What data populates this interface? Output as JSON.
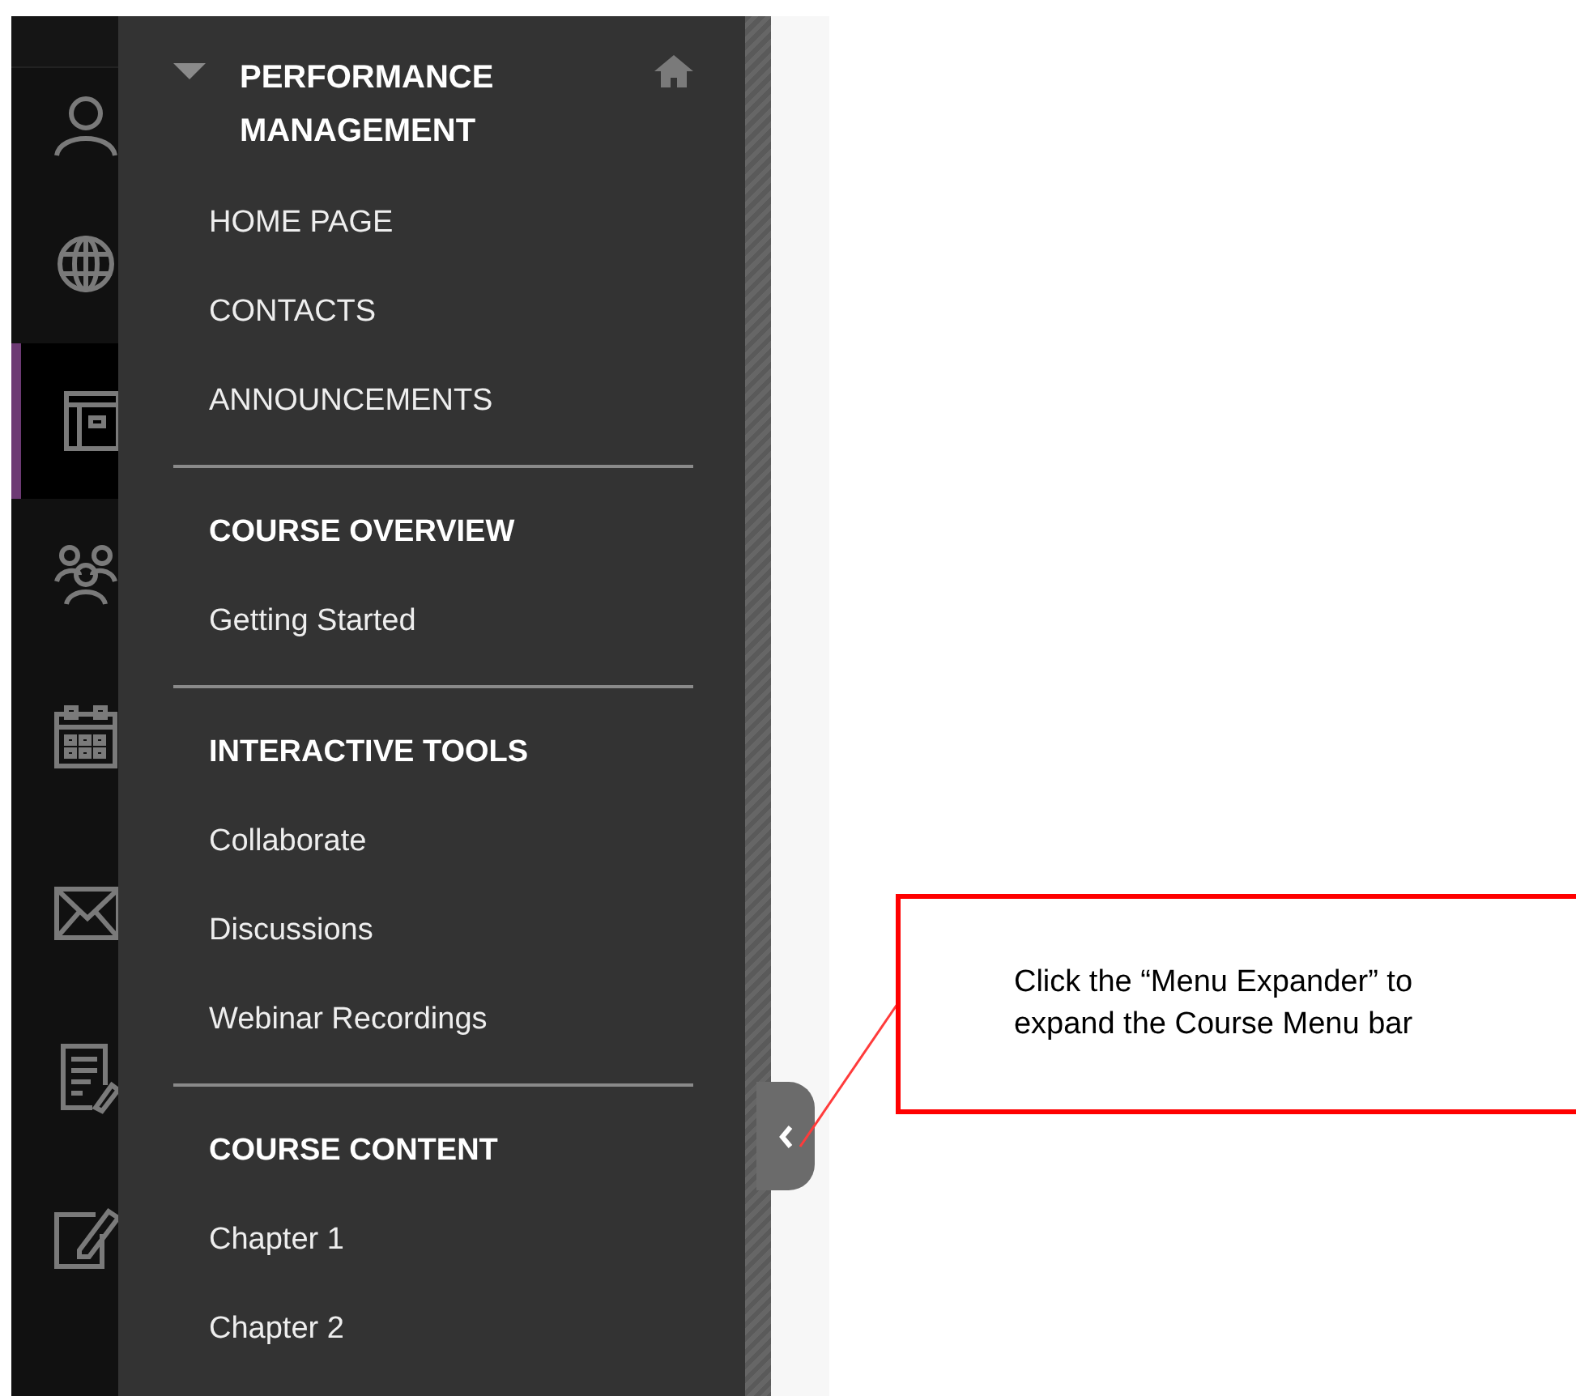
{
  "icon_rail": {
    "items": [
      {
        "selected": false
      },
      {
        "selected": false
      },
      {
        "selected": true
      },
      {
        "selected": false
      },
      {
        "selected": false
      },
      {
        "selected": false
      },
      {
        "selected": false
      },
      {
        "selected": false
      }
    ]
  },
  "course_menu": {
    "title": "PERFORMANCE MANAGEMENT",
    "expanded": true,
    "sections": [
      {
        "items": [
          "HOME PAGE",
          "CONTACTS",
          "ANNOUNCEMENTS"
        ]
      },
      {
        "heading": "COURSE OVERVIEW",
        "items": [
          "Getting Started"
        ]
      },
      {
        "heading": "INTERACTIVE TOOLS",
        "items": [
          "Collaborate",
          "Discussions",
          "Webinar Recordings"
        ]
      },
      {
        "heading": "COURSE CONTENT",
        "items": [
          "Chapter 1",
          "Chapter 2"
        ]
      }
    ]
  },
  "callout": {
    "text": "Click the “Menu Expander” to expand the Course Menu bar"
  }
}
